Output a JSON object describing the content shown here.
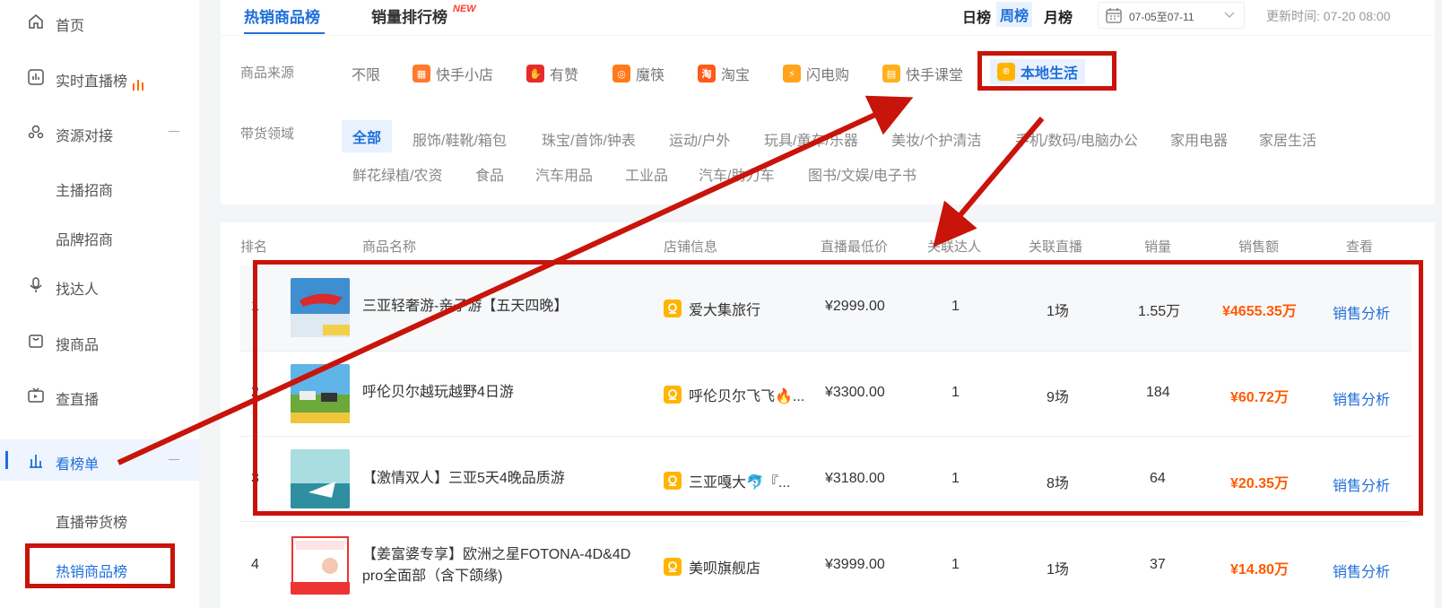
{
  "sidebar": {
    "items": [
      {
        "label": "首页"
      },
      {
        "label": "实时直播榜"
      },
      {
        "label": "资源对接"
      },
      {
        "label": "主播招商"
      },
      {
        "label": "品牌招商"
      },
      {
        "label": "找达人"
      },
      {
        "label": "搜商品"
      },
      {
        "label": "查直播"
      },
      {
        "label": "看榜单"
      },
      {
        "label": "直播带货榜"
      },
      {
        "label": "热销商品榜"
      }
    ]
  },
  "header": {
    "tab_hot": "热销商品榜",
    "tab_sales": "销量排行榜",
    "new_badge": "NEW",
    "rank_day": "日榜",
    "rank_week": "周榜",
    "rank_month": "月榜",
    "date_range": "07-05至07-11",
    "update_time": "更新时间: 07-20 08:00"
  },
  "filters": {
    "source_label": "商品来源",
    "sources": [
      "不限",
      "快手小店",
      "有赞",
      "魔筷",
      "淘宝",
      "闪电购",
      "快手课堂",
      "本地生活"
    ],
    "domain_label": "带货领域",
    "categories_row1": [
      "全部",
      "服饰/鞋靴/箱包",
      "珠宝/首饰/钟表",
      "运动/户外",
      "玩具/童车/乐器",
      "美妆/个护清洁",
      "手机/数码/电脑办公",
      "家用电器",
      "家居生活"
    ],
    "categories_row2": [
      "鲜花绿植/农资",
      "食品",
      "汽车用品",
      "工业品",
      "汽车/助力车",
      "图书/文娱/电子书"
    ]
  },
  "table": {
    "headers": [
      "排名",
      "商品名称",
      "店铺信息",
      "直播最低价",
      "关联达人",
      "关联直播",
      "销量",
      "销售额",
      "查看"
    ],
    "rows": [
      {
        "rank": "1",
        "name": "三亚轻奢游-亲子游【五天四晚】",
        "shop": "爱大集旅行",
        "price": "¥2999.00",
        "anchors": "1",
        "lives": "1场",
        "sales": "1.55万",
        "revenue": "¥4655.35万",
        "action": "销售分析"
      },
      {
        "rank": "2",
        "name": "呼伦贝尔越玩越野4日游",
        "shop": "呼伦贝尔飞飞🔥...",
        "price": "¥3300.00",
        "anchors": "1",
        "lives": "9场",
        "sales": "184",
        "revenue": "¥60.72万",
        "action": "销售分析"
      },
      {
        "rank": "3",
        "name": "【激情双人】三亚5天4晚品质游",
        "shop": "三亚嘎大🐬『...",
        "price": "¥3180.00",
        "anchors": "1",
        "lives": "8场",
        "sales": "64",
        "revenue": "¥20.35万",
        "action": "销售分析"
      },
      {
        "rank": "4",
        "name": "【姜富婆专享】欧洲之星FOTONA-4D&4D pro全面部（含下颌缘)",
        "shop": "美呗旗舰店",
        "price": "¥3999.00",
        "anchors": "1",
        "lives": "1场",
        "sales": "37",
        "revenue": "¥14.80万",
        "action": "销售分析"
      }
    ]
  },
  "colors": {
    "accent": "#1e6fd9",
    "money": "#ff5a00",
    "annotation": "#c8140a"
  }
}
